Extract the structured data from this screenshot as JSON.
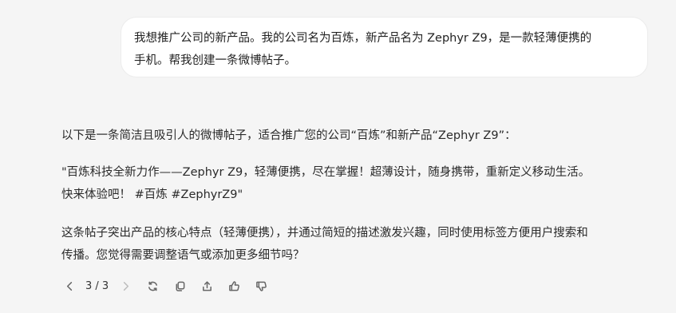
{
  "user_message": {
    "line1": "我想推广公司的新产品。我的公司名为百炼，新产品名为 Zephyr Z9，是一款轻薄便携的",
    "line2": "手机。帮我创建一条微博帖子。"
  },
  "response": {
    "intro": "以下是一条简洁且吸引人的微博帖子，适合推广您的公司“百炼”和新产品“Zephyr Z9”：",
    "post_line1": "\"百炼科技全新力作——Zephyr Z9，轻薄便携，尽在掌握！超薄设计，随身携带，重新定义移动生活。",
    "post_line2": "快来体验吧！ #百炼 #ZephyrZ9\"",
    "summary_line1": "这条帖子突出产品的核心特点（轻薄便携），并通过简短的描述激发兴趣，同时使用标签方便用户搜索和",
    "summary_line2": "传播。您觉得需要调整语气或添加更多细节吗？"
  },
  "actions": {
    "pager": "3 / 3",
    "icons": [
      "chevron-left-icon",
      "chevron-right-icon",
      "regenerate-icon",
      "copy-icon",
      "share-icon",
      "thumbs-up-icon",
      "thumbs-down-icon"
    ]
  }
}
